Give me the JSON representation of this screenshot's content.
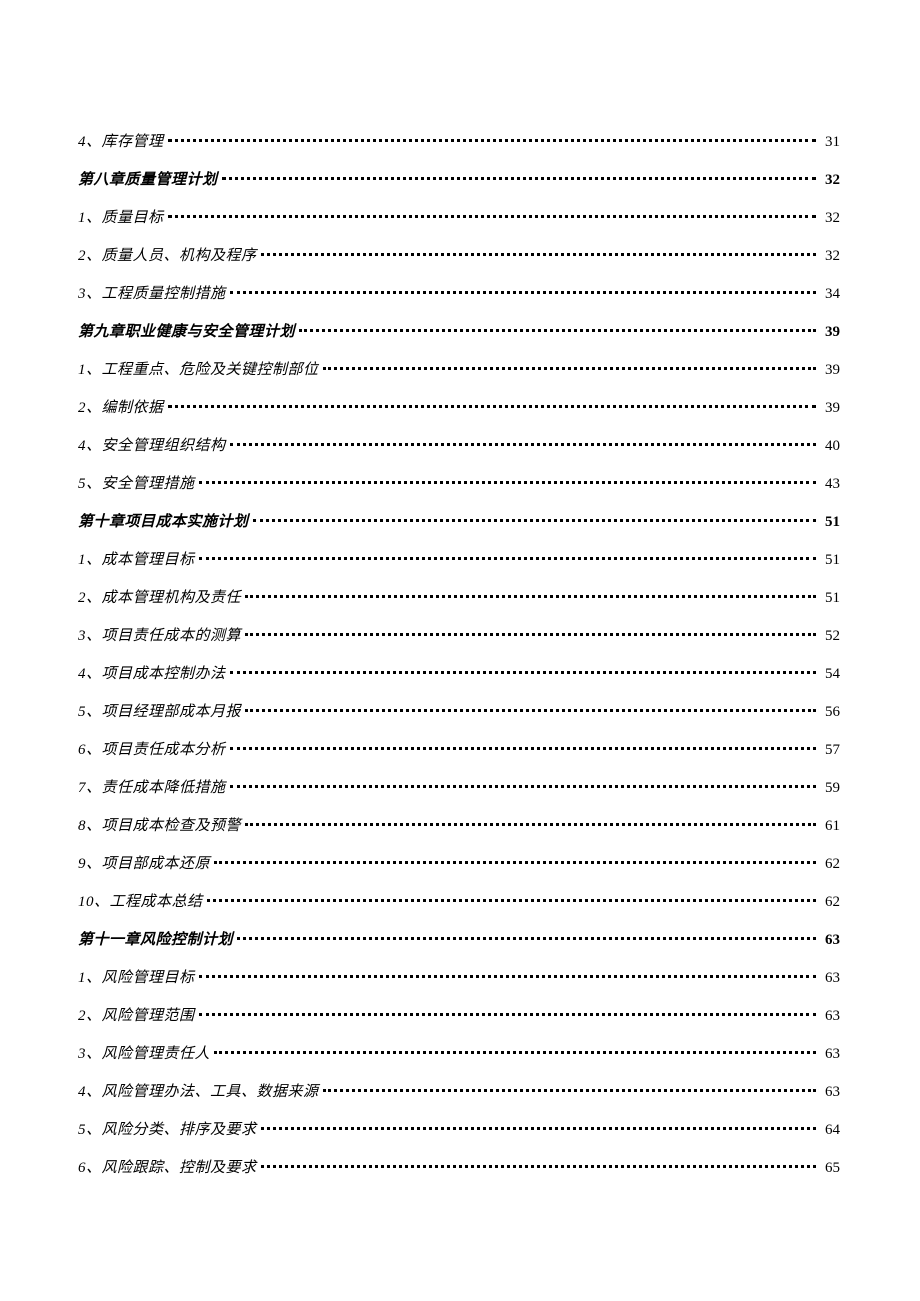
{
  "toc": [
    {
      "title": "4、库存管理",
      "page": "31",
      "chapter": false,
      "ascii_prefix": "4"
    },
    {
      "title": "第八章质量管理计划",
      "page": "32",
      "chapter": true
    },
    {
      "title": "1、质量目标",
      "page": "32",
      "chapter": false,
      "ascii_prefix": "1"
    },
    {
      "title": "2、质量人员、机构及程序",
      "page": "32",
      "chapter": false,
      "ascii_prefix": "2"
    },
    {
      "title": "3、工程质量控制措施",
      "page": "34",
      "chapter": false,
      "ascii_prefix": "3"
    },
    {
      "title": "第九章职业健康与安全管理计划",
      "page": "39",
      "chapter": true
    },
    {
      "title": "1、工程重点、危险及关键控制部位",
      "page": "39",
      "chapter": false,
      "ascii_prefix": "1"
    },
    {
      "title": "2、编制依据",
      "page": "39",
      "chapter": false,
      "ascii_prefix": "2"
    },
    {
      "title": "4、安全管理组织结构",
      "page": "40",
      "chapter": false,
      "ascii_prefix": "4"
    },
    {
      "title": "5、安全管理措施",
      "page": "43",
      "chapter": false,
      "ascii_prefix": "5"
    },
    {
      "title": "第十章项目成本实施计划",
      "page": "51",
      "chapter": true
    },
    {
      "title": "1、成本管理目标",
      "page": "51",
      "chapter": false,
      "ascii_prefix": "1"
    },
    {
      "title": "2、成本管理机构及责任",
      "page": "51",
      "chapter": false,
      "ascii_prefix": "2"
    },
    {
      "title": "3、项目责任成本的测算",
      "page": "52",
      "chapter": false,
      "ascii_prefix": "3"
    },
    {
      "title": "4、项目成本控制办法",
      "page": "54",
      "chapter": false,
      "ascii_prefix": "4"
    },
    {
      "title": "5、项目经理部成本月报",
      "page": "56",
      "chapter": false,
      "ascii_prefix": "5"
    },
    {
      "title": "6、项目责任成本分析",
      "page": "57",
      "chapter": false,
      "ascii_prefix": "6"
    },
    {
      "title": "7、责任成本降低措施",
      "page": "59",
      "chapter": false,
      "ascii_prefix": "7"
    },
    {
      "title": "8、项目成本检查及预警",
      "page": "61",
      "chapter": false,
      "ascii_prefix": "8"
    },
    {
      "title": "9、项目部成本还原",
      "page": "62",
      "chapter": false,
      "ascii_prefix": "9"
    },
    {
      "title": "10、工程成本总结",
      "page": "62",
      "chapter": false,
      "ascii_prefix": "10"
    },
    {
      "title": "第十一章风险控制计划",
      "page": "63",
      "chapter": true
    },
    {
      "title": "1、风险管理目标",
      "page": "63",
      "chapter": false,
      "ascii_prefix": "1"
    },
    {
      "title": "2、风险管理范围",
      "page": "63",
      "chapter": false,
      "ascii_prefix": "2"
    },
    {
      "title": "3、风险管理责任人",
      "page": "63",
      "chapter": false,
      "ascii_prefix": "3"
    },
    {
      "title": "4、风险管理办法、工具、数据来源",
      "page": "63",
      "chapter": false,
      "ascii_prefix": "4"
    },
    {
      "title": "5、风险分类、排序及要求",
      "page": "64",
      "chapter": false,
      "ascii_prefix": "5"
    },
    {
      "title": "6、风险跟踪、控制及要求",
      "page": "65",
      "chapter": false,
      "ascii_prefix": "6"
    }
  ]
}
